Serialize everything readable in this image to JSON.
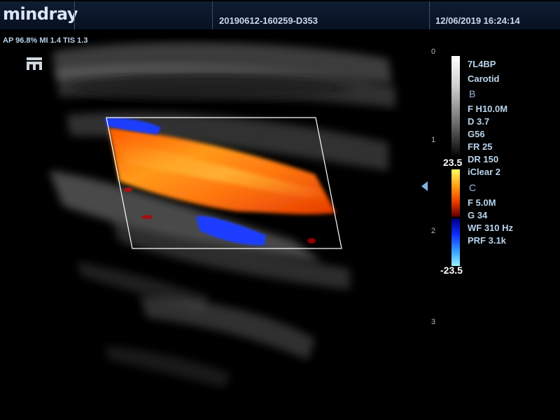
{
  "header": {
    "brand": "mindray",
    "study_id": "20190612-160259-D353",
    "datetime": "12/06/2019  16:24:14"
  },
  "status": {
    "acoustic": "AP 96.8%  MI 1.4 TIS 1.3"
  },
  "depth_scale": {
    "labels": [
      "0",
      "1",
      "2",
      "3"
    ]
  },
  "probe": {
    "name": "7L4BP",
    "preset": "Carotid"
  },
  "b_mode": {
    "header": "B",
    "params": [
      "F H10.0M",
      "D 3.7",
      "G56",
      "FR 25",
      "DR 150",
      "iClear 2"
    ]
  },
  "color_mode": {
    "header": "C",
    "scale_max": "23.5",
    "scale_min": "-23.5",
    "params": [
      "F 5.0M",
      "G 34",
      "WF 310 Hz",
      "PRF 3.1k"
    ]
  },
  "colors": {
    "flow_red": "#ff6a0a",
    "flow_blue": "#1a3cff",
    "text": "#b8d4ec"
  },
  "icons": [
    "mindray-m-icon",
    "focus-marker-icon"
  ]
}
